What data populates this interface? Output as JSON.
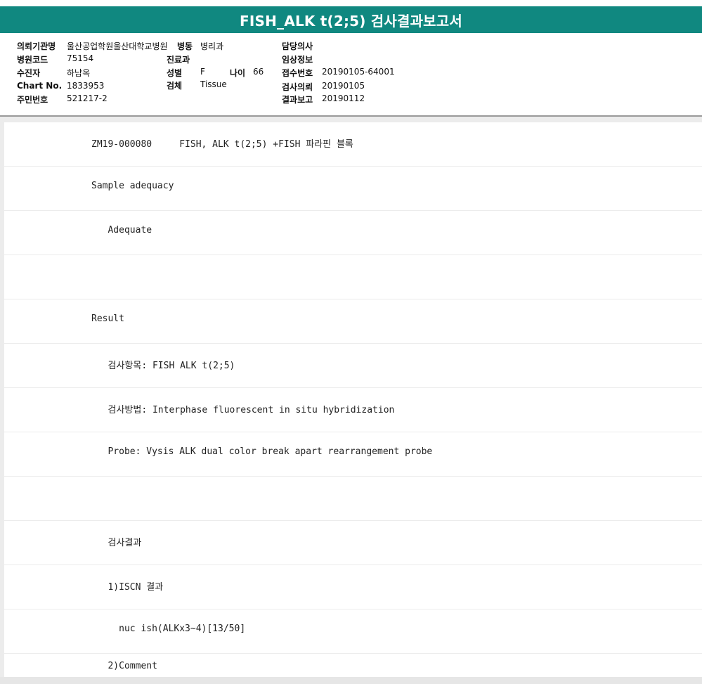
{
  "title": "FISH_ALK t(2;5) 검사결과보고서",
  "patient_info": {
    "institution_label": "의뢰기관명",
    "institution_value": "울산공업학원울산대학교병원",
    "ward_label": "병동",
    "ward_value": "병리과",
    "doctor_label": "담당의사",
    "hospital_code_label": "병원코드",
    "hospital_code_value": "75154",
    "dept_label": "진료과",
    "clinical_info_label": "임상정보",
    "examinee_label": "수진자",
    "examinee_value": "하남옥",
    "sex_label": "성별",
    "sex_value": "F",
    "age_label": "나이",
    "age_value": "66",
    "receipt_no_label": "접수번호",
    "receipt_no_value": "20190105-64001",
    "chart_no_label": "Chart No.",
    "chart_no_value": "1833953",
    "specimen_label": "검체",
    "specimen_value": "Tissue",
    "request_label": "검사의뢰",
    "request_value": "20190105",
    "resident_no_label": "주민번호",
    "resident_no_value": "521217-2",
    "report_label": "결과보고",
    "report_value": "20190112"
  },
  "report_lines": [
    "ZM19-000080     FISH, ALK t(2;5) +FISH 파라핀 블록",
    "Sample adequacy",
    "   Adequate",
    "",
    "Result",
    "   검사항목: FISH ALK t(2;5)",
    "   검사방법: Interphase fluorescent in situ hybridization",
    "   Probe: Vysis ALK dual color break apart rearrangement probe",
    "",
    "   검사결과",
    "   1)ISCN 결과",
    "     nuc ish(ALKx3~4)[13/50]",
    "   2)Comment"
  ]
}
